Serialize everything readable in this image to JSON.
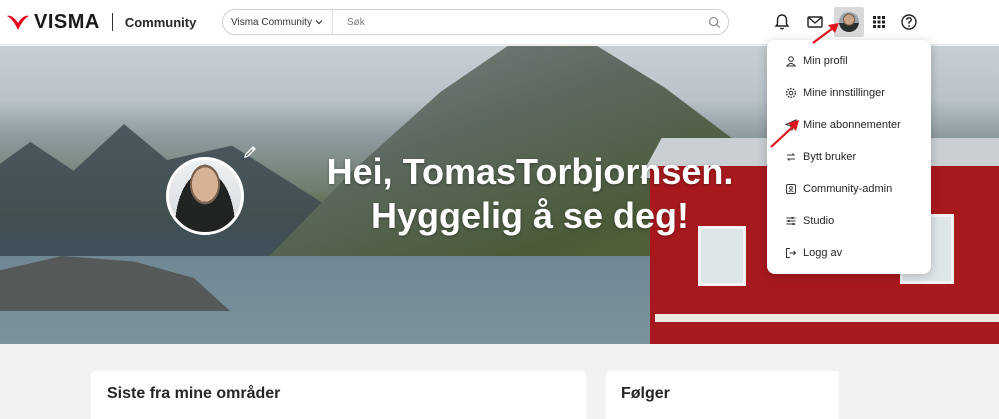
{
  "header": {
    "logo_text": "VISMA",
    "community_label": "Community",
    "search_scope": "Visma Community",
    "search_placeholder": "Søk",
    "icons": [
      "bell-icon",
      "mail-icon",
      "avatar",
      "apps-grid-icon",
      "help-icon"
    ]
  },
  "hero": {
    "greeting_line1": "Hei, TomasTorbjornsen.",
    "greeting_line2": "Hyggelig å se deg!"
  },
  "user_menu": {
    "items": [
      {
        "label": "Min profil",
        "icon": "user-icon"
      },
      {
        "label": "Mine innstillinger",
        "icon": "settings-icon"
      },
      {
        "label": "Mine abonnementer",
        "icon": "send-icon"
      },
      {
        "label": "Bytt bruker",
        "icon": "switch-user-icon"
      },
      {
        "label": "Community-admin",
        "icon": "admin-icon"
      },
      {
        "label": "Studio",
        "icon": "sliders-icon"
      },
      {
        "label": "Logg av",
        "icon": "logout-icon"
      }
    ]
  },
  "cards": {
    "left_title": "Siste fra mine områder",
    "right_title": "Følger"
  },
  "colors": {
    "brand_red": "#e2001a",
    "annotation_red": "#e0141e"
  }
}
